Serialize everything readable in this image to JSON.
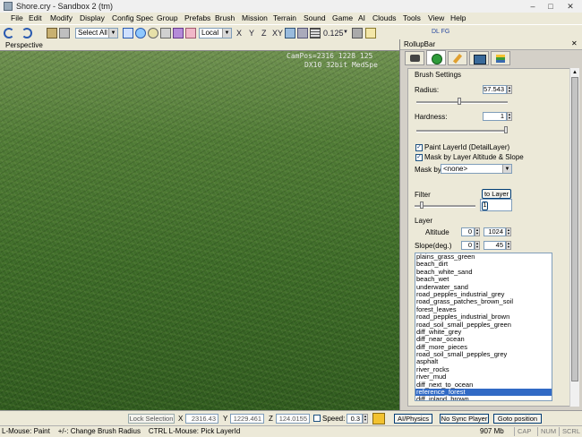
{
  "window": {
    "title": "Shore.cry - Sandbox 2 (tm)",
    "min": "–",
    "max": "□",
    "close": "✕"
  },
  "menu": [
    "File",
    "Edit",
    "Modify",
    "Display",
    "Config Spec",
    "Group",
    "Prefabs",
    "Brush",
    "Mission",
    "Terrain",
    "Sound",
    "Game",
    "AI",
    "Clouds",
    "Tools",
    "View",
    "Help"
  ],
  "toolbar": {
    "selection": "Select All",
    "coord": "Local",
    "axis_x": "X",
    "axis_y": "Y",
    "axis_z": "Z",
    "axis_xy": "XY",
    "grid": "0.125",
    "extra": "DL FG"
  },
  "viewport": {
    "title": "Perspective",
    "info_line1": "CamPos=2316 1228 125",
    "info_line2": "DX10 32bit MedSpe"
  },
  "rollup": {
    "title": "RollupBar",
    "tab_icons": [
      "camera-icon",
      "green-brush-icon",
      "pencil-icon",
      "monitor-icon",
      "layers-icon"
    ],
    "brush_settings": "Brush Settings",
    "radius_label": "Radius:",
    "radius_value": "57.543",
    "radius_fraction": 0.47,
    "hardness_label": "Hardness:",
    "hardness_value": "1",
    "hardness_fraction": 1.0,
    "paint_layer_label": "Paint LayerId (DetailLayer)",
    "mask_layer_label": "Mask by Layer Altitude & Slope",
    "mask_by_label": "Mask by",
    "mask_by_value": "<none>",
    "filter_label": "Filter",
    "to_layer": "to Layer",
    "filter_value": "1",
    "filter_fraction": 0.1,
    "layer_label": "Layer",
    "altitude_label": "Altitude",
    "altitude_min": "0",
    "altitude_max": "1024",
    "slope_label": "Slope(deg.)",
    "slope_min": "0",
    "slope_max": "45",
    "layers": [
      "plains_grass_green",
      "beach_dirt",
      "beach_white_sand",
      "beach_wet",
      "underwater_sand",
      "road_pepples_industrial_grey",
      "road_grass_patches_brown_soil",
      "forest_leaves",
      "road_pepples_industrial_brown",
      "road_soil_small_pepples_green",
      "diff_white_grey",
      "diff_near_ocean",
      "diff_more_pieces",
      "road_soil_small_pepples_grey",
      "asphalt",
      "river_rocks",
      "river_mud",
      "diff_next_to_ocean",
      "reference_forest",
      "diff_inland_brown"
    ],
    "selected_layer": "reference_forest"
  },
  "bottom": {
    "lock_selection": "Lock Selection",
    "x_label": "X",
    "x_value": "2316.43",
    "y_label": "Y",
    "y_value": "1229.461",
    "z_label": "Z",
    "z_value": "124.0155",
    "speed_label": "Speed:",
    "speed_value": "0.3",
    "ai_physics": "AI/Physics",
    "no_sync": "No Sync Player",
    "goto": "Goto position"
  },
  "status": {
    "hint": "L-Mouse: Paint    +/-: Change Brush Radius    CTRL L-Mouse: Pick LayerId",
    "memory": "907 Mb",
    "cap": "CAP",
    "num": "NUM",
    "scrl": "SCRL"
  }
}
